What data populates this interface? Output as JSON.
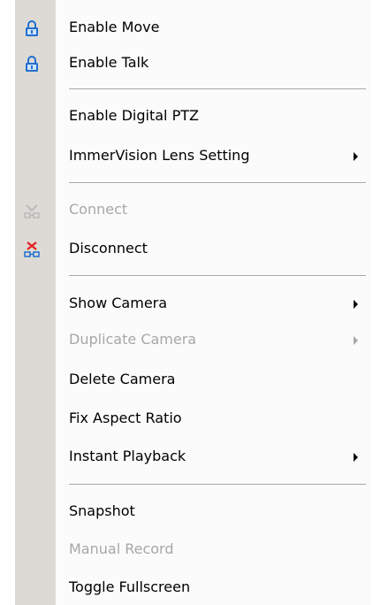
{
  "menu": {
    "enable_move": {
      "label": "Enable Move",
      "icon": "lock-icon"
    },
    "enable_talk": {
      "label": "Enable Talk",
      "icon": "lock-icon"
    },
    "enable_digital_ptz": {
      "label": "Enable Digital PTZ"
    },
    "immervision_lens_setting": {
      "label": "ImmerVision Lens Setting",
      "submenu": true
    },
    "connect": {
      "label": "Connect",
      "disabled": true,
      "icon": "connect-icon"
    },
    "disconnect": {
      "label": "Disconnect",
      "icon": "disconnect-icon"
    },
    "show_camera": {
      "label": "Show Camera",
      "submenu": true
    },
    "duplicate_camera": {
      "label": "Duplicate Camera",
      "disabled": true,
      "submenu": true
    },
    "delete_camera": {
      "label": "Delete Camera"
    },
    "fix_aspect_ratio": {
      "label": "Fix Aspect Ratio"
    },
    "instant_playback": {
      "label": "Instant Playback",
      "submenu": true
    },
    "snapshot": {
      "label": "Snapshot"
    },
    "manual_record": {
      "label": "Manual Record",
      "disabled": true
    },
    "toggle_fullscreen": {
      "label": "Toggle Fullscreen"
    }
  },
  "colors": {
    "menu_background": "#fbfbfb",
    "gutter": "#dddad5",
    "text": "#000000",
    "disabled_text": "#a7a6aa",
    "lock_icon": "#1f6fd1",
    "disconnect_x": "#e32424"
  }
}
